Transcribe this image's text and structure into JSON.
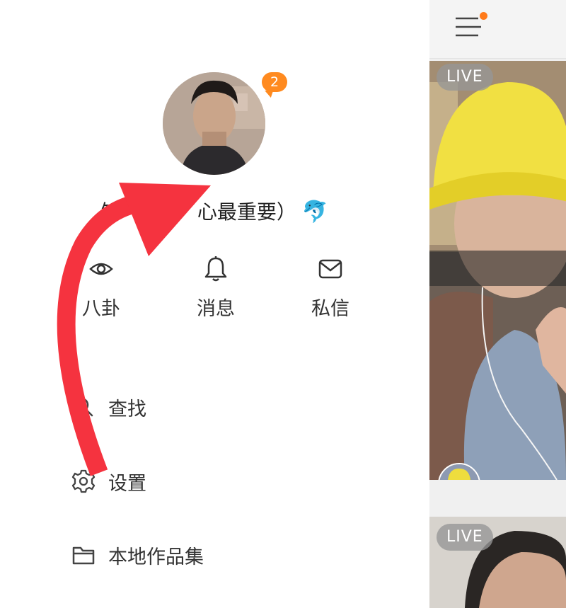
{
  "profile": {
    "badge_count": "2",
    "nickname": "知",
    "nickname_rest": "心最重要）",
    "nickname_emoji": "🐬"
  },
  "quick_actions": [
    {
      "label": "八卦",
      "icon": "eye-icon"
    },
    {
      "label": "消息",
      "icon": "bell-icon"
    },
    {
      "label": "私信",
      "icon": "mail-icon"
    }
  ],
  "menu": [
    {
      "label": "查找",
      "icon": "search-icon"
    },
    {
      "label": "设置",
      "icon": "gear-icon"
    },
    {
      "label": "本地作品集",
      "icon": "folder-icon"
    }
  ],
  "feed": {
    "live_label_1": "LIVE",
    "live_label_2": "LIVE",
    "notification_dot_color": "#ff7a1a"
  },
  "colors": {
    "accent": "#ff8a1f",
    "arrow": "#f5333f"
  }
}
